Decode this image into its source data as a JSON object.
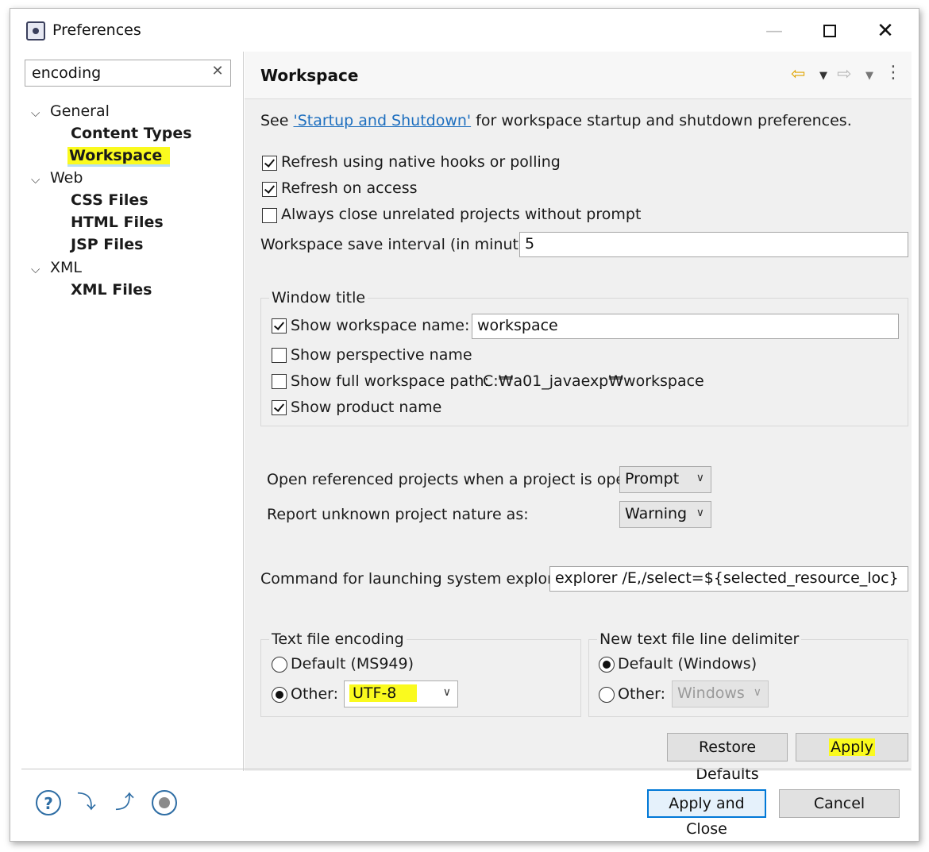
{
  "window": {
    "title": "Preferences",
    "minimize_icon": "minimize-icon",
    "maximize_icon": "maximize-icon",
    "close_glyph": "✕"
  },
  "sidebar": {
    "filter_value": "encoding",
    "clear_glyph": "✕",
    "tree": [
      {
        "label": "General",
        "children": [
          "Content Types",
          "Workspace"
        ]
      },
      {
        "label": "Web",
        "children": [
          "CSS Files",
          "HTML Files",
          "JSP Files"
        ]
      },
      {
        "label": "XML",
        "children": [
          "XML Files"
        ]
      }
    ],
    "selected": "Workspace"
  },
  "page": {
    "title": "Workspace",
    "nav_icons": [
      "back-arrow-icon",
      "dropdown-icon",
      "forward-arrow-icon",
      "dropdown-icon",
      "view-menu-icon"
    ],
    "intro_prefix": "See ",
    "intro_link": "'Startup and Shutdown'",
    "intro_suffix": " for workspace startup and shutdown preferences.",
    "refresh_native": {
      "label": "Refresh using native hooks or polling",
      "checked": true
    },
    "refresh_access": {
      "label": "Refresh on access",
      "checked": true
    },
    "close_unrelated": {
      "label": "Always close unrelated projects without prompt",
      "checked": false
    },
    "save_interval_label": "Workspace save interval (in minutes):",
    "save_interval_value": "5",
    "window_title_group": {
      "legend": "Window title",
      "show_workspace_name": {
        "label": "Show workspace name:",
        "checked": true,
        "value": "workspace"
      },
      "show_perspective_name": {
        "label": "Show perspective name",
        "checked": false
      },
      "show_full_path": {
        "label": "Show full workspace path:",
        "checked": false,
        "path": "C:₩a01_javaexp₩workspace"
      },
      "show_product_name": {
        "label": "Show product name",
        "checked": true
      }
    },
    "open_referenced_label": "Open referenced projects when a project is opened:",
    "open_referenced_value": "Prompt",
    "report_unknown_label": "Report unknown project nature as:",
    "report_unknown_value": "Warning",
    "explorer_label": "Command for launching system explorer:",
    "explorer_value": "explorer /E,/select=${selected_resource_loc}",
    "encoding_group": {
      "legend": "Text file encoding",
      "default_label": "Default (MS949)",
      "other_label": "Other:",
      "selected": "Other",
      "other_value": "UTF-8"
    },
    "delimiter_group": {
      "legend": "New text file line delimiter",
      "default_label": "Default (Windows)",
      "other_label": "Other:",
      "selected": "Default",
      "other_value": "Windows"
    },
    "restore_defaults": "Restore Defaults",
    "apply": "Apply"
  },
  "footer": {
    "icons": [
      "help-icon",
      "import-icon",
      "export-icon",
      "record-icon"
    ],
    "apply_and_close": "Apply and Close",
    "cancel": "Cancel"
  },
  "colors": {
    "highlight": "#fafa1e",
    "link": "#1e6fbf",
    "default_button_border": "#0078d7"
  }
}
